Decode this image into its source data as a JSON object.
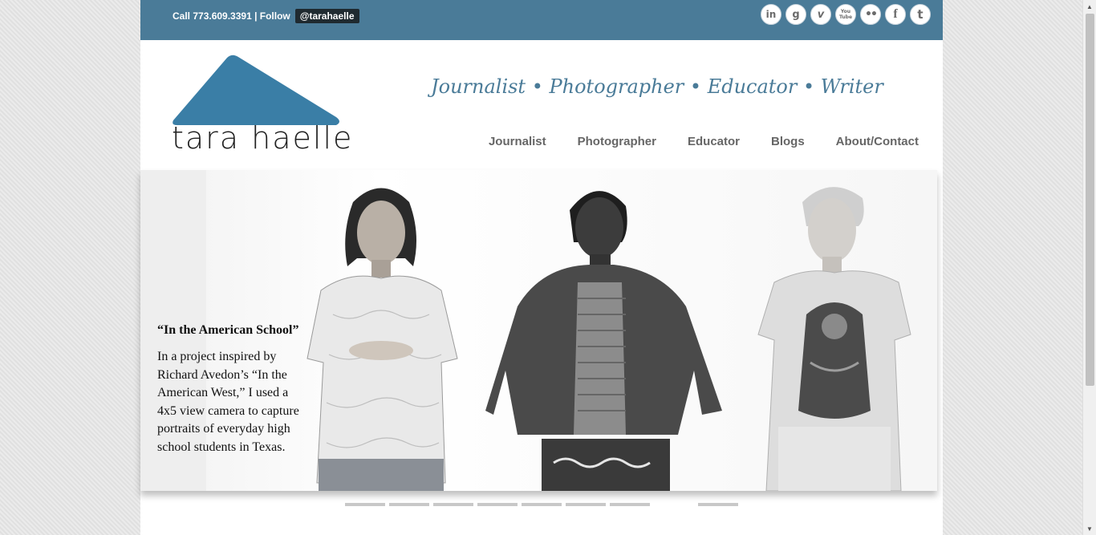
{
  "header": {
    "contact_prefix": "Call 773.609.3391 | Follow",
    "twitter_handle": "@tarahaelle",
    "social": [
      {
        "icon": "linkedin-icon",
        "glyph": "in"
      },
      {
        "icon": "google-plus-icon",
        "glyph": "g"
      },
      {
        "icon": "vimeo-icon",
        "glyph": "v"
      },
      {
        "icon": "youtube-icon",
        "glyph": "You Tube"
      },
      {
        "icon": "flickr-icon",
        "glyph": "••"
      },
      {
        "icon": "facebook-icon",
        "glyph": "f"
      },
      {
        "icon": "twitter-icon",
        "glyph": "t"
      }
    ]
  },
  "brand": {
    "name": "tara haelle",
    "tagline": "Journalist • Photographer • Educator • Writer",
    "logo_color": "#3a7ea6"
  },
  "nav": [
    "Journalist",
    "Photographer",
    "Educator",
    "Blogs",
    "About/Contact"
  ],
  "hero": {
    "title": "“In the American School”",
    "body": "In a project inspired by Richard Avedon’s “In the American West,” I used a 4x5 view camera to capture portraits of everyday high school students in Texas."
  },
  "slider": {
    "slides": 9,
    "empty_index": 7
  },
  "colors": {
    "topbar": "#4a7b98",
    "page_bg": "#e4e4e4"
  }
}
